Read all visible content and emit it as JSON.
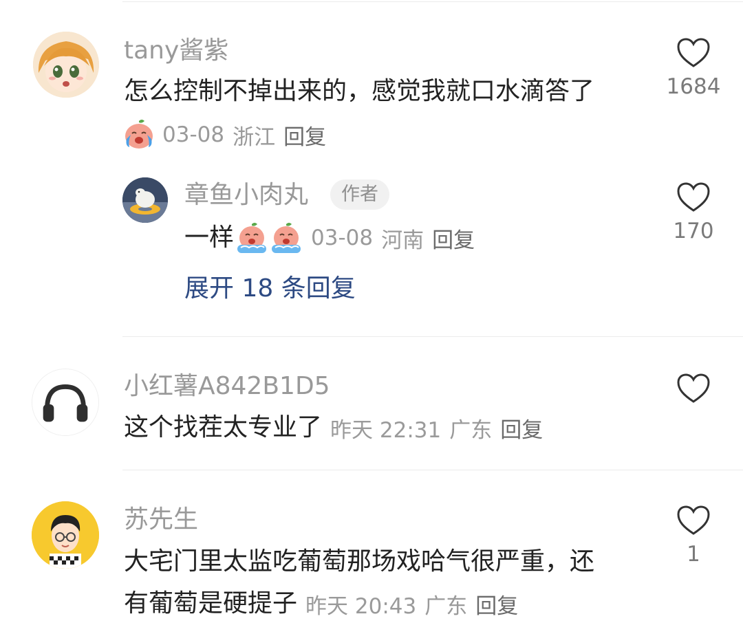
{
  "comments": [
    {
      "username": "tany酱紫",
      "text": "怎么控制不掉出来的，感觉我就口水滴答了",
      "date": "03-08",
      "location": "浙江",
      "reply_label": "回复",
      "likes": "1684",
      "reply": {
        "username": "章鱼小肉丸",
        "author_tag": "作者",
        "text": "一样",
        "date": "03-08",
        "location": "河南",
        "reply_label": "回复",
        "likes": "170"
      },
      "expand_label": "展开 18 条回复"
    },
    {
      "username": "小红薯A842B1D5",
      "text": "这个找茬太专业了",
      "date": "昨天 22:31",
      "location": "广东",
      "reply_label": "回复",
      "likes": ""
    },
    {
      "username": "苏先生",
      "text_line1": "大宅门里太监吃葡萄那场戏哈气很严重，还",
      "text_line2": "有葡萄是硬提子",
      "date": "昨天 20:43",
      "location": "广东",
      "reply_label": "回复",
      "likes": "1"
    }
  ],
  "colors": {
    "username": "#999999",
    "text": "#222222",
    "link": "#2d4a83",
    "divider": "#ebebeb"
  }
}
